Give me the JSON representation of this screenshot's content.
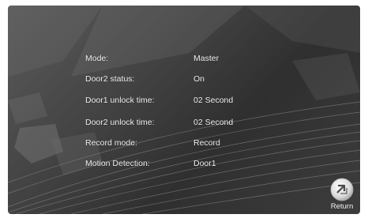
{
  "settings": [
    {
      "label": "Mode:",
      "value": "Master"
    },
    {
      "label": "Door2 status:",
      "value": "On"
    },
    {
      "label": "Door1 unlock time:",
      "value": "02 Second"
    },
    {
      "label": "Door2 unlock time:",
      "value": "02 Second"
    },
    {
      "label": "Record mode:",
      "value": "Record"
    },
    {
      "label": "Motion Detection:",
      "value": "Door1"
    }
  ],
  "return_button": {
    "label": "Return",
    "icon": "return-icon"
  },
  "colors": {
    "text": "#f2f2f2",
    "background": "#3a3a3a"
  }
}
